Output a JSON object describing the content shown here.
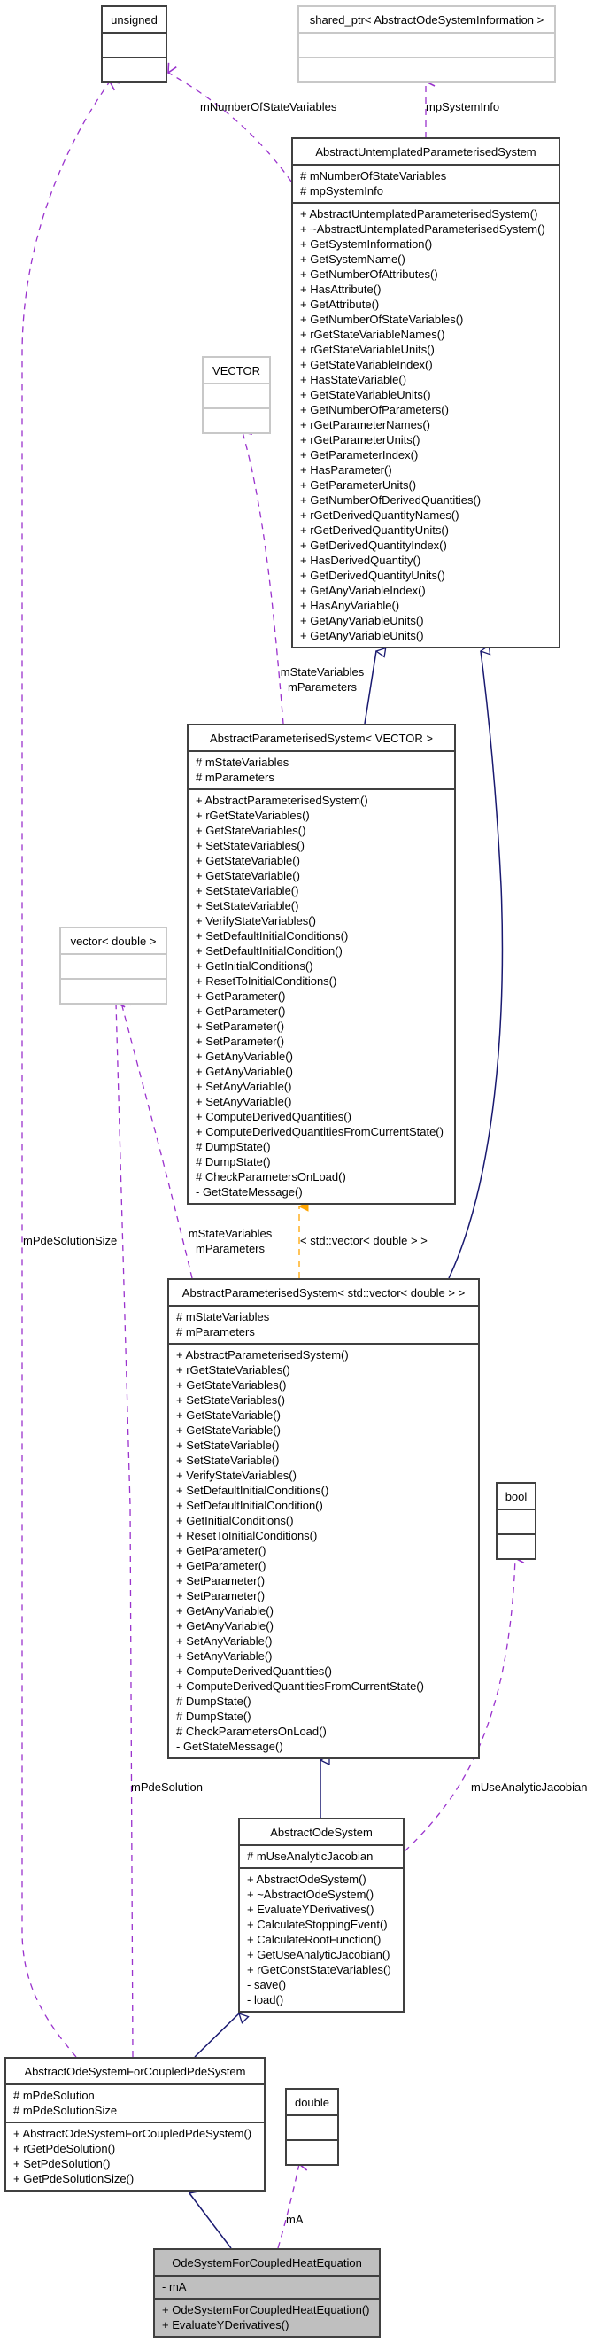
{
  "classes": {
    "unsigned": {
      "title": "unsigned",
      "attributes": [],
      "methods": []
    },
    "shared_ptr": {
      "title": "shared_ptr< AbstractOdeSystemInformation >",
      "attributes": [],
      "methods": []
    },
    "untemplated": {
      "title": "AbstractUntemplatedParameterisedSystem",
      "attributes": [
        "# mNumberOfStateVariables",
        "# mpSystemInfo"
      ],
      "methods": [
        "+ AbstractUntemplatedParameterisedSystem()",
        "+ ~AbstractUntemplatedParameterisedSystem()",
        "+ GetSystemInformation()",
        "+ GetSystemName()",
        "+ GetNumberOfAttributes()",
        "+ HasAttribute()",
        "+ GetAttribute()",
        "+ GetNumberOfStateVariables()",
        "+ rGetStateVariableNames()",
        "+ rGetStateVariableUnits()",
        "+ GetStateVariableIndex()",
        "+ HasStateVariable()",
        "+ GetStateVariableUnits()",
        "+ GetNumberOfParameters()",
        "+ rGetParameterNames()",
        "+ rGetParameterUnits()",
        "+ GetParameterIndex()",
        "+ HasParameter()",
        "+ GetParameterUnits()",
        "+ GetNumberOfDerivedQuantities()",
        "+ rGetDerivedQuantityNames()",
        "+ rGetDerivedQuantityUnits()",
        "+ GetDerivedQuantityIndex()",
        "+ HasDerivedQuantity()",
        "+ GetDerivedQuantityUnits()",
        "+ GetAnyVariableIndex()",
        "+ HasAnyVariable()",
        "+ GetAnyVariableUnits()",
        "+ GetAnyVariableUnits()"
      ]
    },
    "vector_tpl": {
      "title": "VECTOR",
      "attributes": [],
      "methods": []
    },
    "aps_vector": {
      "title": "AbstractParameterisedSystem< VECTOR >",
      "attributes": [
        "# mStateVariables",
        "# mParameters"
      ],
      "methods": [
        "+ AbstractParameterisedSystem()",
        "+ rGetStateVariables()",
        "+ GetStateVariables()",
        "+ SetStateVariables()",
        "+ GetStateVariable()",
        "+ GetStateVariable()",
        "+ SetStateVariable()",
        "+ SetStateVariable()",
        "+ VerifyStateVariables()",
        "+ SetDefaultInitialConditions()",
        "+ SetDefaultInitialCondition()",
        "+ GetInitialConditions()",
        "+ ResetToInitialConditions()",
        "+ GetParameter()",
        "+ GetParameter()",
        "+ SetParameter()",
        "+ SetParameter()",
        "+ GetAnyVariable()",
        "+ GetAnyVariable()",
        "+ SetAnyVariable()",
        "+ SetAnyVariable()",
        "+ ComputeDerivedQuantities()",
        "+ ComputeDerivedQuantitiesFromCurrentState()",
        "# DumpState()",
        "# DumpState()",
        "# CheckParametersOnLoad()",
        "- GetStateMessage()"
      ]
    },
    "vector_double": {
      "title": "vector< double >",
      "attributes": [],
      "methods": []
    },
    "aps_std_vector": {
      "title": "AbstractParameterisedSystem< std::vector< double > >",
      "attributes": [
        "# mStateVariables",
        "# mParameters"
      ],
      "methods": [
        "+ AbstractParameterisedSystem()",
        "+ rGetStateVariables()",
        "+ GetStateVariables()",
        "+ SetStateVariables()",
        "+ GetStateVariable()",
        "+ GetStateVariable()",
        "+ SetStateVariable()",
        "+ SetStateVariable()",
        "+ VerifyStateVariables()",
        "+ SetDefaultInitialConditions()",
        "+ SetDefaultInitialCondition()",
        "+ GetInitialConditions()",
        "+ ResetToInitialConditions()",
        "+ GetParameter()",
        "+ GetParameter()",
        "+ SetParameter()",
        "+ SetParameter()",
        "+ GetAnyVariable()",
        "+ GetAnyVariable()",
        "+ SetAnyVariable()",
        "+ SetAnyVariable()",
        "+ ComputeDerivedQuantities()",
        "+ ComputeDerivedQuantitiesFromCurrentState()",
        "# DumpState()",
        "# DumpState()",
        "# CheckParametersOnLoad()",
        "- GetStateMessage()"
      ]
    },
    "bool": {
      "title": "bool",
      "attributes": [],
      "methods": []
    },
    "ode_system": {
      "title": "AbstractOdeSystem",
      "attributes": [
        "# mUseAnalyticJacobian"
      ],
      "methods": [
        "+ AbstractOdeSystem()",
        "+ ~AbstractOdeSystem()",
        "+ EvaluateYDerivatives()",
        "+ CalculateStoppingEvent()",
        "+ CalculateRootFunction()",
        "+ GetUseAnalyticJacobian()",
        "+ rGetConstStateVariables()",
        "- save()",
        "- load()"
      ]
    },
    "ode_coupled_pde": {
      "title": "AbstractOdeSystemForCoupledPdeSystem",
      "attributes": [
        "# mPdeSolution",
        "# mPdeSolutionSize"
      ],
      "methods": [
        "+ AbstractOdeSystemForCoupledPdeSystem()",
        "+ rGetPdeSolution()",
        "+ SetPdeSolution()",
        "+ GetPdeSolutionSize()"
      ]
    },
    "double": {
      "title": "double",
      "attributes": [],
      "methods": []
    },
    "heat_eq": {
      "title": "OdeSystemForCoupledHeatEquation",
      "attributes": [
        "- mA"
      ],
      "methods": [
        "+ OdeSystemForCoupledHeatEquation()",
        "+ EvaluateYDerivatives()"
      ]
    }
  },
  "edge_labels": {
    "mNumberOfStateVariables": "mNumberOfStateVariables",
    "mpSystemInfo": "mpSystemInfo",
    "vector_members_1": "mStateVariables",
    "vector_members_2": "mParameters",
    "std_vector_members_1": "mStateVariables",
    "std_vector_members_2": "mParameters",
    "template_arg": "< std::vector< double > >",
    "mPdeSolutionSize": "mPdeSolutionSize",
    "mPdeSolution": "mPdeSolution",
    "mUseAnalyticJacobian": "mUseAnalyticJacobian",
    "mA": "mA"
  },
  "colors": {
    "inheritance": "#191970",
    "usage": "#9a32cd",
    "template": "#ffa500",
    "focus_fill": "#bfbfbf",
    "border": "#404040",
    "ghost_border": "#c8c8c8"
  }
}
